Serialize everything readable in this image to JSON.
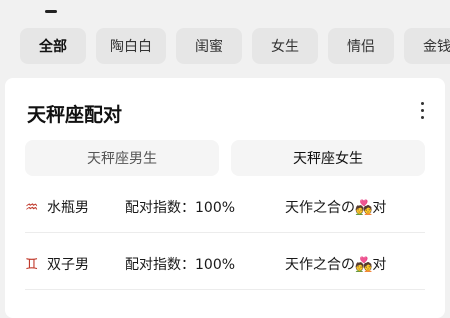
{
  "tabs": [
    "全部",
    "陶白白",
    "闺蜜",
    "女生",
    "情侣",
    "金钱"
  ],
  "card": {
    "title": "天秤座配对",
    "header": {
      "male": "天秤座男生",
      "female": "天秤座女生"
    },
    "rows": [
      {
        "symbol": "♒",
        "male": "水瓶男",
        "score": "配对指数：100%",
        "partner": "天作之合の💑对"
      },
      {
        "symbol": "♊",
        "male": "双子男",
        "score": "配对指数：100%",
        "partner": "天作之合の💑对"
      }
    ]
  },
  "colors": {
    "accent": "#c0392b",
    "page_bg": "#f1f1f1",
    "tab_bg": "#e6e6e6"
  },
  "icons": {
    "more": "more-vertical-icon",
    "aquarius": "aquarius-icon",
    "gemini": "gemini-icon"
  }
}
